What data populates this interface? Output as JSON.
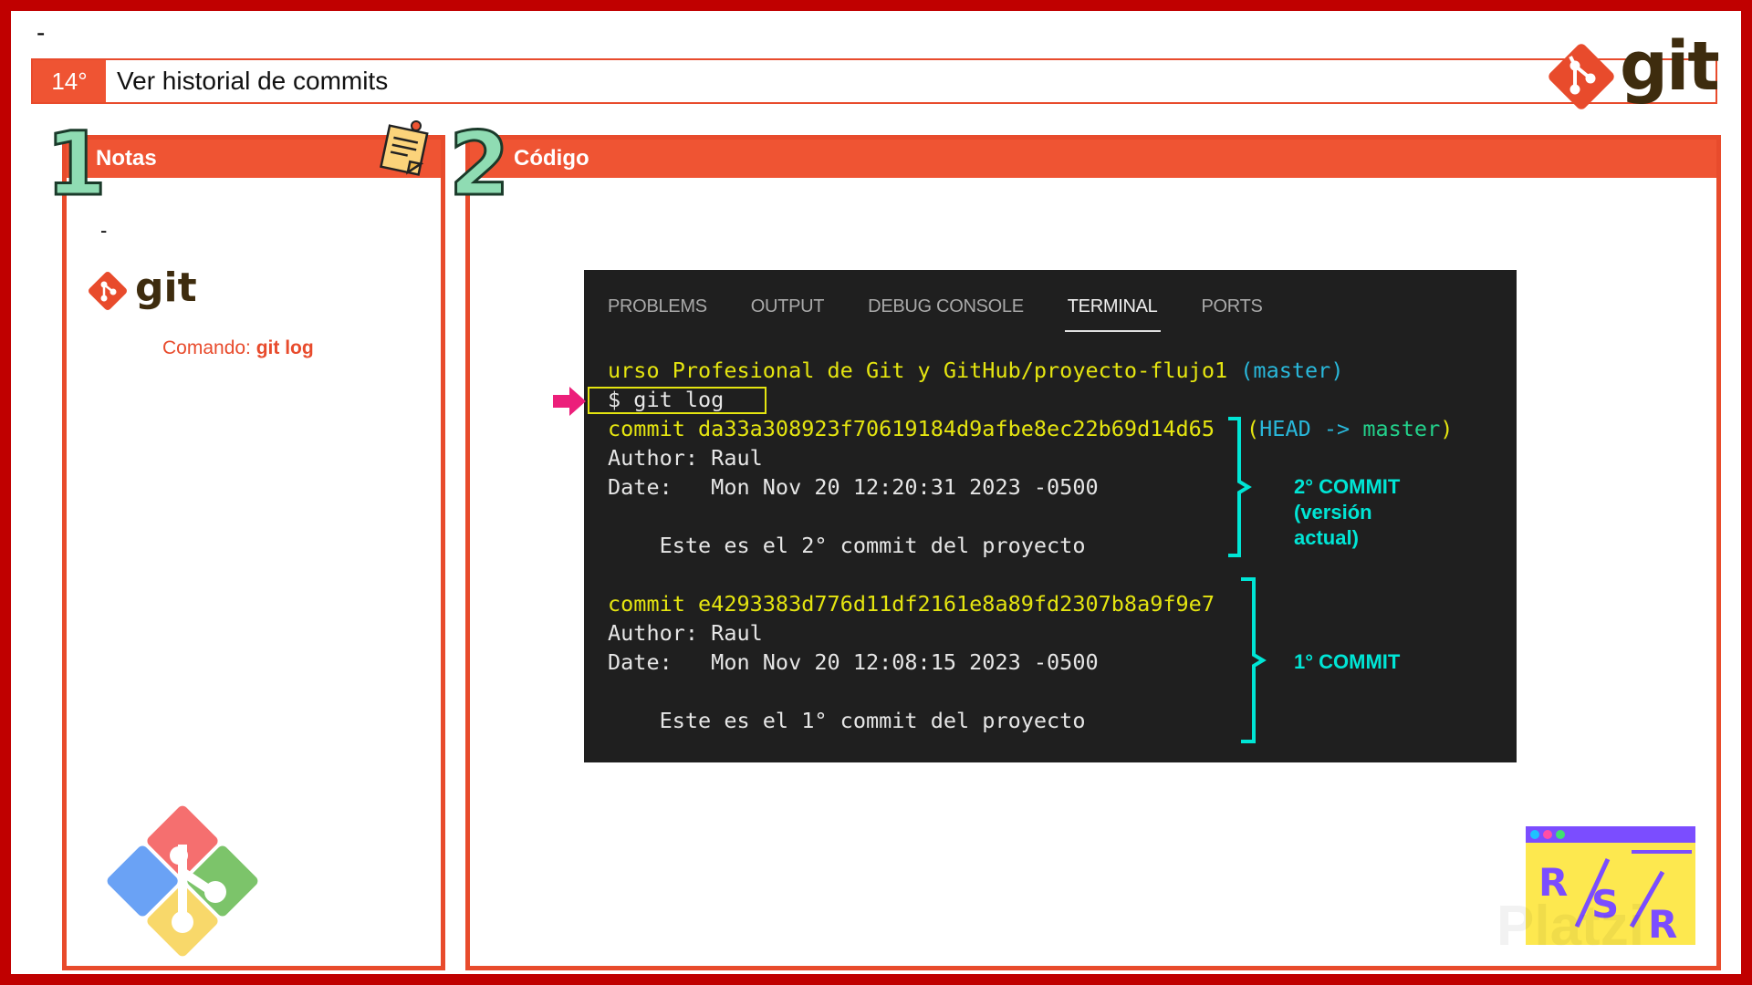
{
  "slide": {
    "top_dash": "-",
    "number": "14°",
    "title": "Ver historial de commits",
    "brand_word": "git"
  },
  "notes_panel": {
    "index": "1",
    "title": "Notas",
    "dash": "-",
    "brand_word": "git",
    "command_label": "Comando: ",
    "command_value": "git log"
  },
  "code_panel": {
    "index": "2",
    "title": "Código"
  },
  "terminal": {
    "tabs": [
      {
        "label": "PROBLEMS",
        "active": false
      },
      {
        "label": "OUTPUT",
        "active": false
      },
      {
        "label": "DEBUG CONSOLE",
        "active": false
      },
      {
        "label": "TERMINAL",
        "active": true
      },
      {
        "label": "PORTS",
        "active": false
      }
    ],
    "path": "urso Profesional de Git y GitHub/proyecto-flujo1",
    "branch": "(master)",
    "prompt": "$ git log",
    "commits": [
      {
        "hash_line": "commit da33a308923f70619184d9afbe8ec22b69d14d65",
        "head_open": "(",
        "head_label": "HEAD -> ",
        "head_branch": "master",
        "head_close": ")",
        "author": "Author: Raul",
        "date": "Date:   Mon Nov 20 12:20:31 2023 -0500",
        "message": "    Este es el 2° commit del proyecto"
      },
      {
        "hash_line": "commit e4293383d776d11df2161e8a89fd2307b8a9f9e7",
        "author": "Author: Raul",
        "date": "Date:   Mon Nov 20 12:08:15 2023 -0500",
        "message": "    Este es el 1° commit del proyecto"
      }
    ]
  },
  "annotations": {
    "second_commit": [
      "2°  COMMIT",
      "(versión",
      "actual)"
    ],
    "first_commit": "1° COMMIT"
  },
  "rsr_logo_text": [
    "R",
    "S",
    "R"
  ],
  "watermark": "Platzi",
  "colors": {
    "accent": "#ef5433",
    "frame": "#c00000",
    "terminal_bg": "#1f1f1f",
    "terminal_yellow": "#e5e510",
    "annotation_cyan": "#00e5d5"
  }
}
